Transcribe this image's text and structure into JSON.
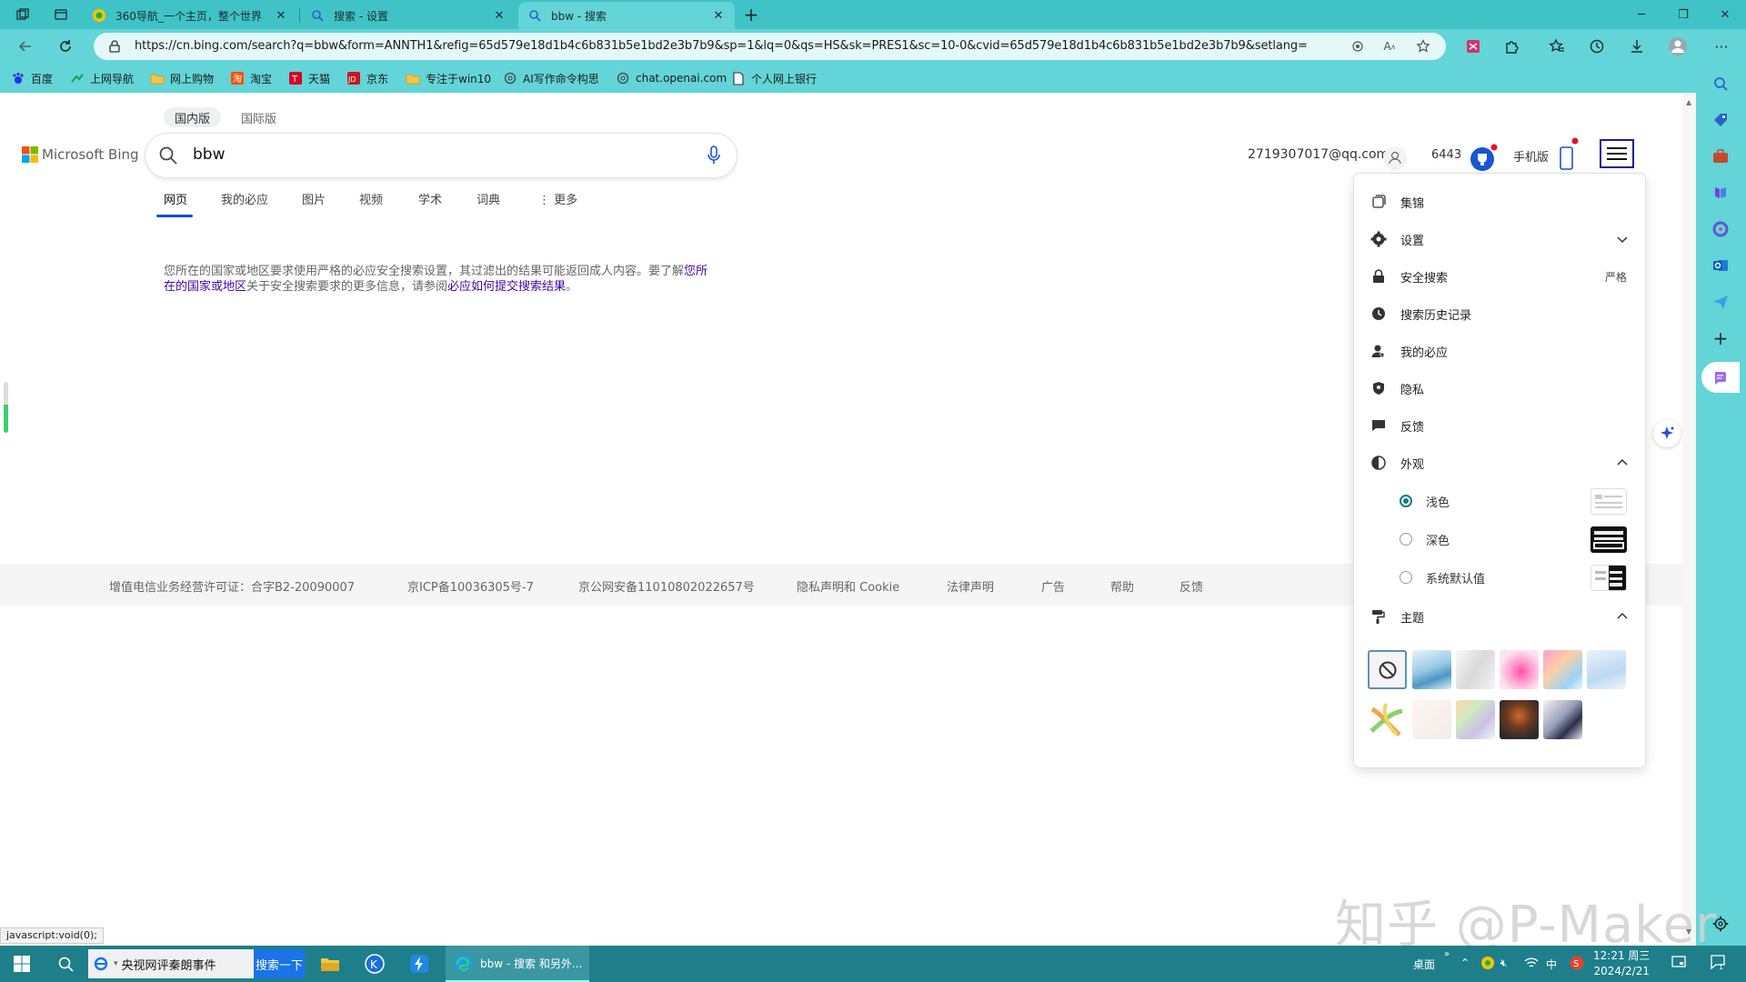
{
  "browser": {
    "tabs": [
      {
        "title": "360导航_一个主页，整个世界",
        "favicon": "360-icon",
        "active": false
      },
      {
        "title": "搜索 - 设置",
        "favicon": "search-icon",
        "active": false
      },
      {
        "title": "bbw - 搜索",
        "favicon": "search-icon",
        "active": true
      }
    ],
    "new_tab_symbol": "+",
    "url": "https://cn.bing.com/search?q=bbw&form=ANNTH1&refig=65d579e18d1b4c6b831b5e1bd2e3b7b9&sp=1&lq=0&qs=HS&sk=PRES1&sc=10-0&cvid=65d579e18d1b4c6b831b5e1bd2e3b7b9&setlang=zh-Hans&c...",
    "favorites": [
      {
        "label": "百度",
        "icon": "baidu-icon"
      },
      {
        "label": "上网导航",
        "icon": "nav-icon"
      },
      {
        "label": "网上购物",
        "icon": "folder-icon"
      },
      {
        "label": "淘宝",
        "icon": "taobao-icon"
      },
      {
        "label": "天猫",
        "icon": "tmall-icon"
      },
      {
        "label": "京东",
        "icon": "jd-icon"
      },
      {
        "label": "专注于win10",
        "icon": "folder-icon"
      },
      {
        "label": "AI写作命令构思",
        "icon": "openai-icon"
      },
      {
        "label": "chat.openai.com",
        "icon": "openai-icon"
      },
      {
        "label": "个人网上银行",
        "icon": "page-icon"
      }
    ],
    "status_bar": "javascript:void(0);"
  },
  "bing": {
    "regions": [
      "国内版",
      "国际版"
    ],
    "logo_text": "Microsoft Bing",
    "query": "bbw",
    "scopes": [
      "网页",
      "我的必应",
      "图片",
      "视频",
      "学术",
      "词典",
      "更多"
    ],
    "notice": {
      "text1": "您所在的国家或地区要求使用严格的必应安全搜索设置，其过滤出的结果可能返回成人内容。要了解",
      "link1": "您所在的国家或地区",
      "text2": "关于安全搜索要求的更多信息，请参阅",
      "link2": "必应如何提交搜索结果",
      "text3": "。"
    },
    "account": {
      "email": "2719307017@qq.com",
      "points": "6443",
      "mobile": "手机版"
    },
    "footer": [
      "增值电信业务经营许可证：合字B2-20090007",
      "京ICP备10036305号-7",
      "京公网安备11010802022657号",
      "隐私声明和 Cookie",
      "法律声明",
      "广告",
      "帮助",
      "反馈"
    ]
  },
  "menu": {
    "items": [
      {
        "label": "集锦",
        "icon": "collections-icon"
      },
      {
        "label": "设置",
        "icon": "gear-icon"
      },
      {
        "label": "安全搜索",
        "icon": "lock-icon",
        "value": "严格"
      },
      {
        "label": "搜索历史记录",
        "icon": "history-icon"
      },
      {
        "label": "我的必应",
        "icon": "person-icon"
      },
      {
        "label": "隐私",
        "icon": "shield-icon"
      },
      {
        "label": "反馈",
        "icon": "feedback-icon"
      },
      {
        "label": "外观",
        "icon": "appearance-icon"
      }
    ],
    "appearance_options": [
      {
        "label": "浅色",
        "selected": true
      },
      {
        "label": "深色",
        "selected": false
      },
      {
        "label": "系统默认值",
        "selected": false
      }
    ],
    "theme_label": "主题"
  },
  "taskbar": {
    "search_text": "央视网评秦朗事件",
    "search_button": "搜索一下",
    "edge_window": "bbw - 搜索 和另外...",
    "desktop_label": "桌面",
    "ime": "中",
    "time": "12:21 周三",
    "date": "2024/2/21"
  },
  "watermark": "知乎 @P-Maker",
  "colors": {
    "browser_accent": "#63d4d7",
    "tabbar": "#3fc3c7",
    "bing_blue": "#174ae4",
    "taskbar": "#1e7f8a"
  }
}
